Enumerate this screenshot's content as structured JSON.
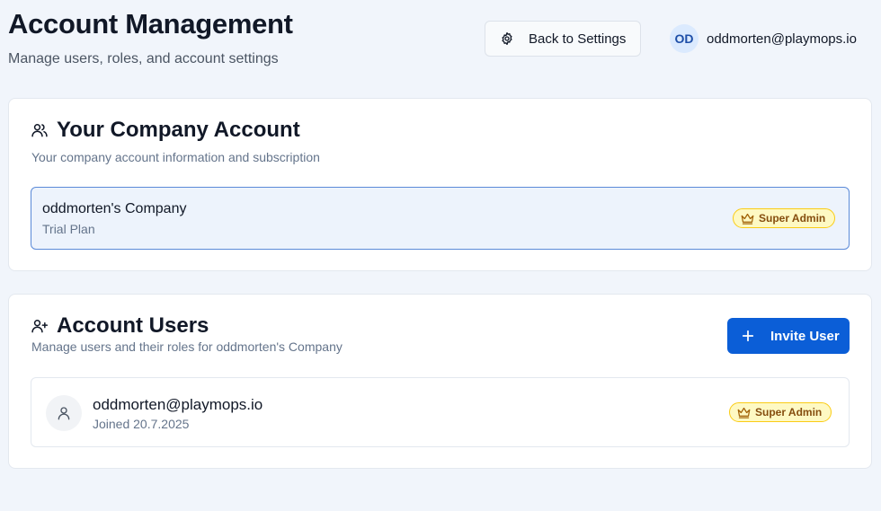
{
  "header": {
    "title": "Account Management",
    "subtitle": "Manage users, roles, and account settings",
    "back_button_label": "Back to Settings",
    "user_initials": "OD",
    "user_email": "oddmorten@playmops.io"
  },
  "company_card": {
    "title": "Your Company Account",
    "description": "Your company account information and subscription",
    "company_name": "oddmorten's Company",
    "plan": "Trial Plan",
    "role_badge": "Super Admin"
  },
  "users_card": {
    "title": "Account Users",
    "description": "Manage users and their roles for oddmorten's Company",
    "invite_button_label": "Invite User",
    "users": [
      {
        "email": "oddmorten@playmops.io",
        "joined": "Joined 20.7.2025",
        "role": "Super Admin"
      }
    ]
  },
  "icons": {
    "back": "gear-icon",
    "company": "users-icon",
    "account_users": "user-plus-icon",
    "invite": "plus-icon",
    "role": "crown-icon",
    "user_avatar": "user-icon"
  },
  "colors": {
    "accent": "#0b5ed7",
    "badge_bg": "#fef9c3",
    "badge_border": "#facc15",
    "badge_text": "#854d0e",
    "selected_bg": "#edf3fc",
    "selected_border": "#5b8ad8"
  }
}
